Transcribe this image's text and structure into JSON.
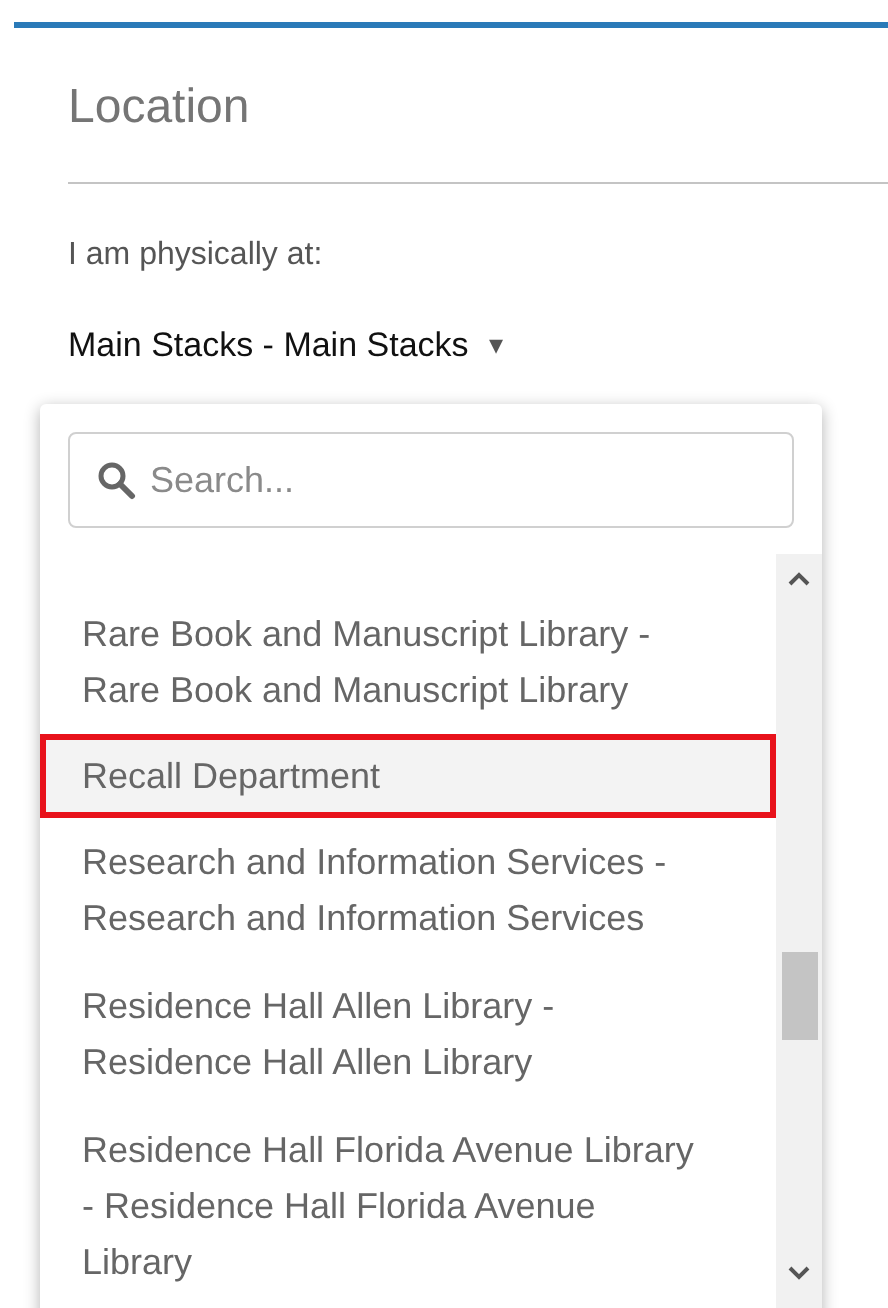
{
  "section": {
    "title": "Location"
  },
  "location_label": "I am physically at:",
  "location_select": {
    "value": "Main Stacks - Main Stacks",
    "caret": "▾",
    "expanded": true
  },
  "search": {
    "placeholder": "Search..."
  },
  "options": [
    {
      "label": "Rare Book and Manuscript Library - Rare Book and Manuscript Library",
      "selected": false,
      "outlined": false
    },
    {
      "label": "Recall Department",
      "selected": true,
      "outlined": true
    },
    {
      "label": "Research and Information Services - Research and Information Services",
      "selected": false,
      "outlined": false
    },
    {
      "label": "Residence Hall Allen Library - Residence Hall Allen Library",
      "selected": false,
      "outlined": false
    },
    {
      "label": "Residence Hall Florida Avenue Library - Residence Hall Florida Avenue Library",
      "selected": false,
      "outlined": false
    }
  ]
}
